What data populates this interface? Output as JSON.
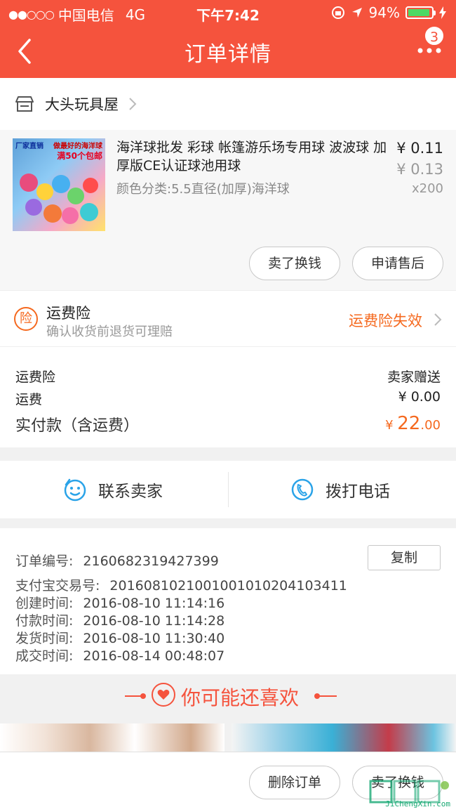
{
  "status_bar": {
    "carrier": "中国电信",
    "network": "4G",
    "time": "下午7:42",
    "battery": "94%",
    "battery_level": 0.94
  },
  "nav": {
    "title": "订单详情",
    "badge": "3"
  },
  "store": {
    "name": "大头玩具屋"
  },
  "product": {
    "title": "海洋球批发 彩球 帐篷游乐场专用球 波波球 加厚版CE认证球池用球",
    "spec": "颜色分类:5.5直径(加厚)海洋球",
    "price": "¥ 0.11",
    "original_price": "¥ 0.13",
    "quantity": "x200",
    "thumb_text_1": "厂家直销",
    "thumb_text_2": "做最好的海洋球",
    "thumb_text_3": "满50个包邮",
    "sell_button": "卖了换钱",
    "after_sale_button": "申请售后"
  },
  "insurance": {
    "icon_text": "险",
    "title": "运费险",
    "subtitle": "确认收货前退货可理赔",
    "status": "运费险失效"
  },
  "fees": {
    "insurance_label": "运费险",
    "insurance_value": "卖家赠送",
    "shipping_label": "运费",
    "shipping_value": "¥ 0.00",
    "total_label": "实付款（含运费）",
    "total_currency": "¥ ",
    "total_int": "22",
    "total_dec": ".00"
  },
  "contact": {
    "seller_label": "联系卖家",
    "phone_label": "拨打电话"
  },
  "order_info": {
    "order_no_label": "订单编号:",
    "order_no": "2160682319427399",
    "copy_button": "复制",
    "alipay_label": "支付宝交易号:",
    "alipay_no": "2016081021001001010204103411",
    "created_label": "创建时间:",
    "created": "2016-08-10 11:14:16",
    "paid_label": "付款时间:",
    "paid": "2016-08-10 11:14:28",
    "shipped_label": "发货时间:",
    "shipped": "2016-08-10 11:30:40",
    "completed_label": "成交时间:",
    "completed": "2016-08-14 00:48:07"
  },
  "recommend": {
    "title": "你可能还喜欢"
  },
  "bottom_bar": {
    "delete_button": "删除订单",
    "sell_button": "卖了换钱"
  },
  "watermark": {
    "text": "JiChengXin.com"
  },
  "colors": {
    "header": "#f5533d",
    "accent_orange": "#f5691f",
    "contact_blue": "#2aa3e8"
  }
}
